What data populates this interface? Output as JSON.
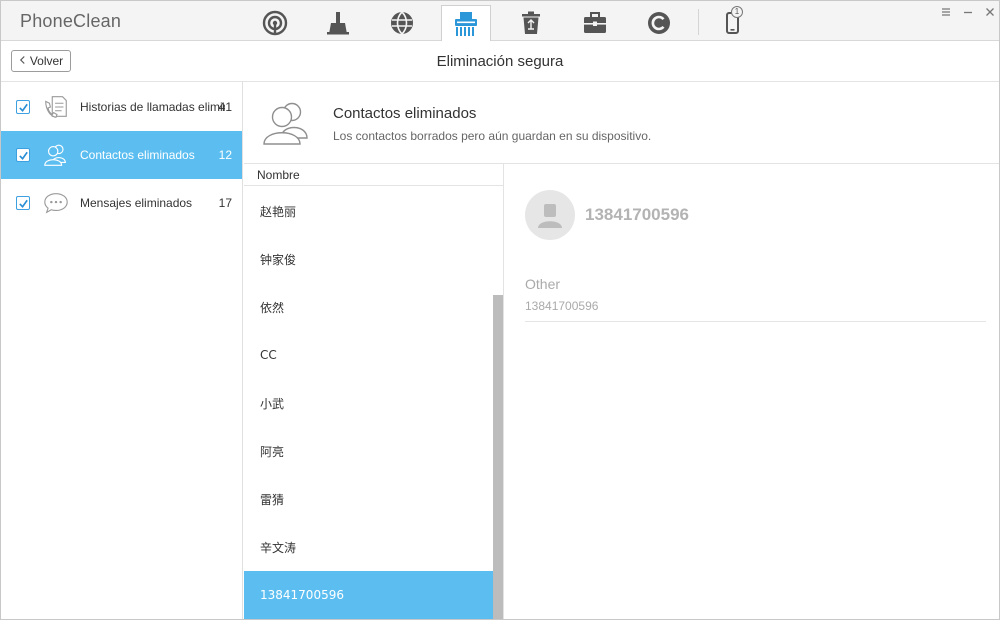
{
  "app": {
    "title": "PhoneClean"
  },
  "toolbar": {
    "tools": [
      {
        "name": "quick-clean",
        "icon": "radar-icon"
      },
      {
        "name": "deep-clean",
        "icon": "broom-icon"
      },
      {
        "name": "internet-clean",
        "icon": "globe-icon"
      },
      {
        "name": "privacy-clean",
        "icon": "shredder-icon",
        "active": true
      },
      {
        "name": "silent-clean",
        "icon": "recycle-bin-icon"
      },
      {
        "name": "toolbox",
        "icon": "briefcase-icon"
      },
      {
        "name": "history",
        "icon": "c-circle-icon"
      }
    ],
    "device_badge": "1"
  },
  "header": {
    "back_label": "Volver",
    "title": "Eliminación segura"
  },
  "sidebar": {
    "items": [
      {
        "label": "Historias de llamadas eliminadas",
        "count": "41",
        "checked": true,
        "icon": "call-log-icon"
      },
      {
        "label": "Contactos eliminados",
        "count": "12",
        "checked": true,
        "active": true,
        "icon": "contacts-icon"
      },
      {
        "label": "Mensajes eliminados",
        "count": "17",
        "checked": true,
        "icon": "message-bubble-icon"
      }
    ]
  },
  "category": {
    "title": "Contactos eliminados",
    "description": "Los contactos borrados pero aún guardan en su dispositivo."
  },
  "list": {
    "column_header": "Nombre",
    "rows": [
      "赵艳丽",
      "钟家俊",
      "依然",
      "CC",
      "小武",
      "阿亮",
      "雷猜",
      "辛文涛",
      "13841700596"
    ],
    "selected_index": 8
  },
  "detail": {
    "name": "13841700596",
    "field_label": "Other",
    "field_value": "13841700596"
  },
  "colors": {
    "accent": "#5cbef0",
    "checkbox": "#3da0e0",
    "toolbar_icon": "#555555",
    "active_tool_icon": "#2b96d8"
  }
}
